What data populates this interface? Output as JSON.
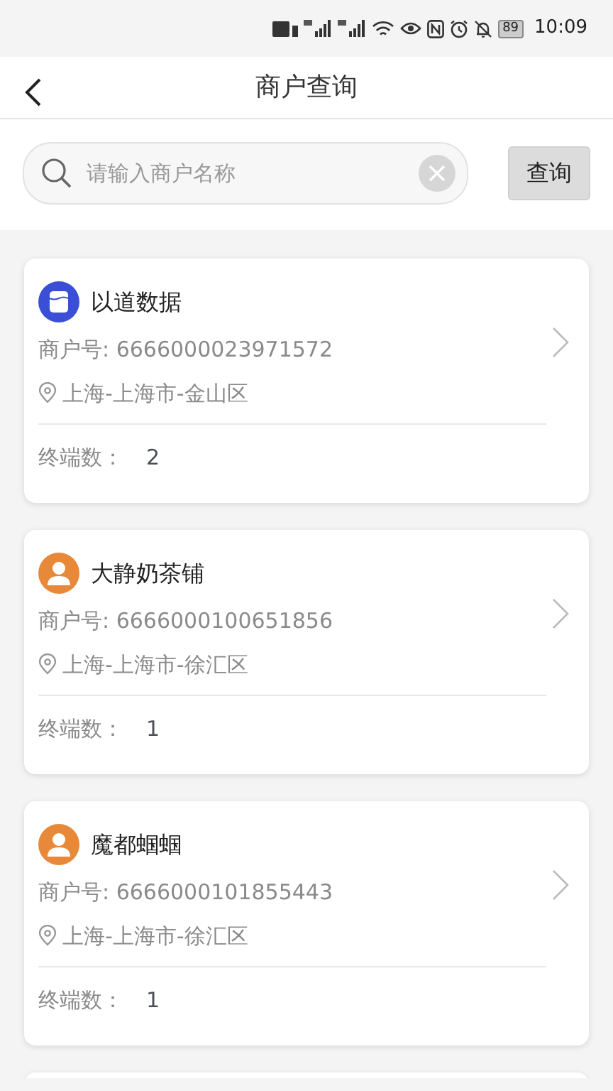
{
  "status_bar": {
    "battery": "89",
    "time": "10:09"
  },
  "header": {
    "title": "商户查询"
  },
  "search": {
    "placeholder": "请输入商户名称",
    "button": "查询"
  },
  "merchants": [
    {
      "name": "以道数据",
      "kind": "logo",
      "color": "#3a4fd6",
      "merchant_no": "商户号: 6666000023971572",
      "location": "上海-上海市-金山区",
      "terminal_label": "终端数：",
      "terminal_count": "2"
    },
    {
      "name": "大静奶茶铺",
      "kind": "person",
      "color": "#e8893a",
      "merchant_no": "商户号: 6666000100651856",
      "location": "上海-上海市-徐汇区",
      "terminal_label": "终端数：",
      "terminal_count": "1"
    },
    {
      "name": "魔都蝈蝈",
      "kind": "person",
      "color": "#e8893a",
      "merchant_no": "商户号: 6666000101855443",
      "location": "上海-上海市-徐汇区",
      "terminal_label": "终端数：",
      "terminal_count": "1"
    }
  ]
}
